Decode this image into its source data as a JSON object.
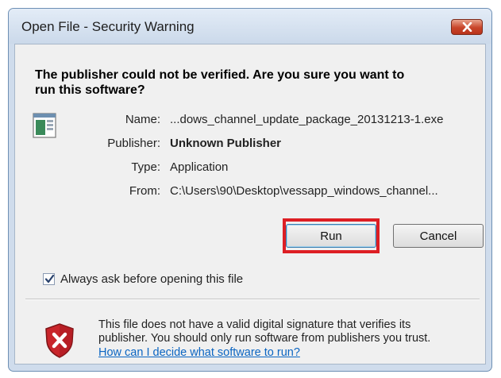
{
  "window": {
    "title": "Open File - Security Warning"
  },
  "dialog": {
    "heading_line1": "The publisher could not be verified.  Are you sure you want to",
    "heading_line2": "run this software?",
    "fields": {
      "name": {
        "label": "Name:",
        "value": "...dows_channel_update_package_20131213-1.exe"
      },
      "publisher": {
        "label": "Publisher:",
        "value": "Unknown Publisher"
      },
      "type": {
        "label": "Type:",
        "value": "Application"
      },
      "from": {
        "label": "From:",
        "value": "C:\\Users\\90\\Desktop\\vessapp_windows_channel..."
      }
    },
    "buttons": {
      "run": "Run",
      "cancel": "Cancel"
    },
    "checkbox": {
      "label": "Always ask before opening this file",
      "checked": true
    },
    "warning": {
      "line1": "This file does not have a valid digital signature that verifies its",
      "line2": "publisher.  You should only run software from publishers you trust.",
      "link": "How can I decide what software to run?"
    }
  },
  "colors": {
    "highlight_box": "#dd1e24",
    "link": "#0b65c2",
    "shield": "#c9252b"
  },
  "icons": {
    "close": "close-icon",
    "application": "application-icon",
    "checkmark": "checkmark-icon",
    "shield": "shield-error-icon"
  }
}
